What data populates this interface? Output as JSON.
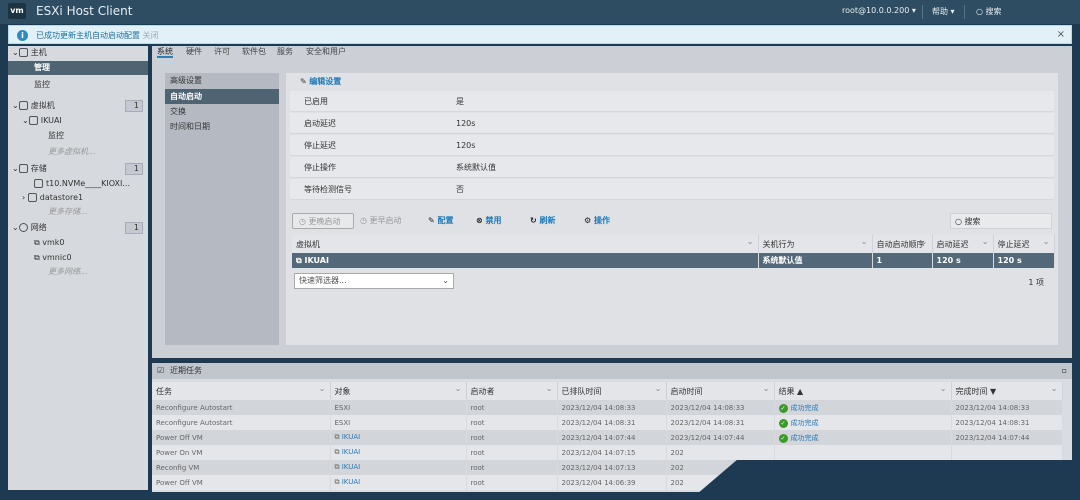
{
  "header": {
    "logo": "vm",
    "title": "ESXi Host Client",
    "user": "root@10.0.0.200 ▾",
    "help": "帮助 ▾",
    "search": "搜索"
  },
  "notification": {
    "message": "已成功更新主机自动启动配置",
    "close_link": "关闭"
  },
  "sidebar": {
    "host": "主机",
    "manage": "管理",
    "monitor": "监控",
    "vms": "虚拟机",
    "vms_count": "1",
    "vm_name": "IKUAI",
    "vm_monitor": "监控",
    "more_vms": "更多虚拟机...",
    "storage": "存储",
    "storage_count": "1",
    "disk": "t10.NVMe____KIOXI...",
    "datastore": "datastore1",
    "more_storage": "更多存储...",
    "network": "网络",
    "network_count": "1",
    "vmk": "vmk0",
    "vmnic": "vmnic0",
    "more_network": "更多网络..."
  },
  "tabs": [
    "系统",
    "硬件",
    "许可",
    "软件包",
    "服务",
    "安全和用户"
  ],
  "subnav": [
    "高级设置",
    "自动启动",
    "交换",
    "时间和日期"
  ],
  "settings": {
    "edit": "编辑设置",
    "rows": [
      {
        "k": "已启用",
        "v": "是"
      },
      {
        "k": "启动延迟",
        "v": "120s"
      },
      {
        "k": "停止延迟",
        "v": "120s"
      },
      {
        "k": "停止操作",
        "v": "系统默认值"
      },
      {
        "k": "等待检测信号",
        "v": "否"
      }
    ]
  },
  "toolbar": {
    "later": "更晚启动",
    "earlier": "更早启动",
    "configure": "配置",
    "disable": "禁用",
    "refresh": "刷新",
    "actions": "操作",
    "search": "搜索"
  },
  "vm_table": {
    "headers": [
      "虚拟机",
      "关机行为",
      "自动启动顺序",
      "启动延迟",
      "停止延迟"
    ],
    "row": [
      "IKUAI",
      "系统默认值",
      "1",
      "120 s",
      "120 s"
    ],
    "filter": "快速筛选器...",
    "count": "1 项"
  },
  "tasks": {
    "title": "近期任务",
    "headers": [
      "任务",
      "对象",
      "启动者",
      "已排队时间",
      "启动时间",
      "结果 ▲",
      "完成时间 ▼"
    ],
    "rows": [
      [
        "Reconfigure Autostart",
        "ESXI",
        "root",
        "2023/12/04 14:08:33",
        "2023/12/04 14:08:33",
        "成功完成",
        "2023/12/04 14:08:33"
      ],
      [
        "Reconfigure Autostart",
        "ESXI",
        "root",
        "2023/12/04 14:08:31",
        "2023/12/04 14:08:31",
        "成功完成",
        "2023/12/04 14:08:31"
      ],
      [
        "Power Off VM",
        "IKUAI",
        "root",
        "2023/12/04 14:07:44",
        "2023/12/04 14:07:44",
        "成功完成",
        "2023/12/04 14:07:44"
      ],
      [
        "Power On VM",
        "IKUAI",
        "root",
        "2023/12/04 14:07:15",
        "202",
        "",
        ""
      ],
      [
        "Reconfig VM",
        "IKUAI",
        "root",
        "2023/12/04 14:07:13",
        "202",
        "",
        ""
      ],
      [
        "Power Off VM",
        "IKUAI",
        "root",
        "2023/12/04 14:06:39",
        "202",
        "",
        ""
      ]
    ]
  }
}
